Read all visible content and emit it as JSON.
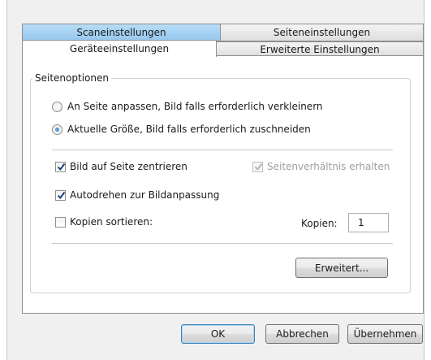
{
  "tabs": {
    "row_back": [
      {
        "label": "Scaneinstellungen",
        "style": "blue"
      },
      {
        "label": "Seiteneinstellungen",
        "style": "gray"
      }
    ],
    "row_front": [
      {
        "label": "Geräteeinstellungen",
        "selected": true
      },
      {
        "label": "Erweiterte Einstellungen",
        "selected": false
      }
    ]
  },
  "group": {
    "title": "Seitenoptionen",
    "radio_fit": {
      "label": "An Seite anpassen, Bild falls erforderlich verkleinern",
      "checked": false
    },
    "radio_actual": {
      "label": "Aktuelle Größe, Bild falls erforderlich zuschneiden",
      "checked": true
    },
    "center_image": {
      "label": "Bild auf Seite zentrieren",
      "checked": true
    },
    "keep_aspect": {
      "label": "Seitenverhältnis erhalten",
      "checked": true,
      "enabled": false
    },
    "autorotate": {
      "label": "Autodrehen zur Bildanpassung",
      "checked": true
    },
    "collate": {
      "label": "Kopien sortieren:",
      "checked": false
    },
    "copies_label": "Kopien:",
    "copies_value": "1",
    "advanced_button": "Erweitert..."
  },
  "footer": {
    "ok": "OK",
    "cancel": "Abbrechen",
    "apply": "Übernehmen"
  },
  "colors": {
    "accent": "#1a5fa8",
    "tab_blue": "#a8d2f2"
  }
}
